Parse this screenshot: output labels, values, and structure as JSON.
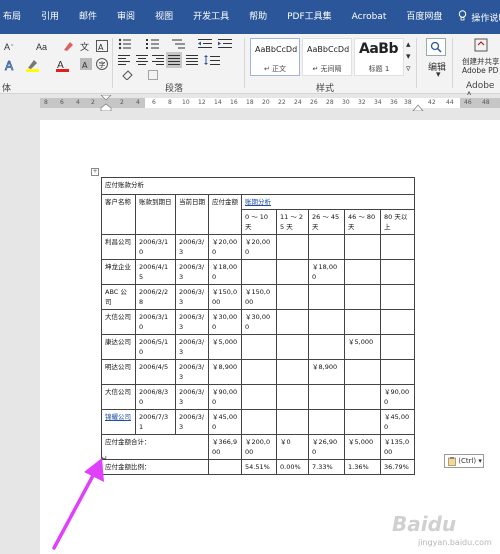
{
  "tabs": [
    "布局",
    "引用",
    "邮件",
    "审阅",
    "视图",
    "开发工具",
    "帮助",
    "PDF工具集",
    "Acrobat",
    "百度网盘"
  ],
  "search_label": "操作说明搜索",
  "ribbon": {
    "font_group_label": "体",
    "paragraph_group_label": "段落",
    "styles_group_label": "样式",
    "editing_label": "编辑",
    "create_label": "创建并共享",
    "adobe_pdf": "Adobe PD",
    "adobe_label": "Adobe A",
    "styles": [
      {
        "preview": "AaBbCcDd",
        "name": "↵ 正文"
      },
      {
        "preview": "AaBbCcDd",
        "name": "↵ 无间隔"
      },
      {
        "preview": "AaBb",
        "name": "标题 1"
      }
    ]
  },
  "ruler": {
    "left_ticks": [
      "8",
      "6",
      "4",
      "2"
    ],
    "ticks": [
      "2",
      "4",
      "6",
      "8",
      "10",
      "12",
      "14",
      "16",
      "18",
      "20",
      "22",
      "24",
      "26",
      "28",
      "30",
      "32",
      "34",
      "36",
      "38"
    ],
    "right_ticks": [
      "42",
      "44",
      "46",
      "48"
    ]
  },
  "table": {
    "title": "应付账款分析",
    "headers": {
      "customer": "客户名称",
      "account_date": "账款到期日",
      "current_date": "当前日期",
      "amount": "应付金额",
      "analysis": "账期分析",
      "buckets": [
        "0 ～ 10 天",
        "11 ～ 25 天",
        "26 ～ 45 天",
        "46 ～ 80 天",
        "80 天以上"
      ]
    },
    "rows": [
      {
        "name": "利昌公司",
        "due": "2006/3/10",
        "now": "2006/3/3",
        "amount": "￥20,000",
        "b": [
          "￥20,000",
          "",
          "",
          "",
          ""
        ]
      },
      {
        "name": "坤龙企业",
        "due": "2006/4/15",
        "now": "2006/3/3",
        "amount": "￥18,000",
        "b": [
          "",
          "",
          "￥18,000",
          "",
          ""
        ]
      },
      {
        "name": "ABC 公司",
        "due": "2006/2/28",
        "now": "2006/3/3",
        "amount": "￥150,000",
        "b": [
          "￥150,000",
          "",
          "",
          "",
          ""
        ]
      },
      {
        "name": "大信公司",
        "due": "2006/3/10",
        "now": "2006/3/3",
        "amount": "￥30,000",
        "b": [
          "￥30,000",
          "",
          "",
          "",
          ""
        ]
      },
      {
        "name": "康达公司",
        "due": "2006/5/10",
        "now": "2006/3/3",
        "amount": "￥5,000",
        "b": [
          "",
          "",
          "",
          "￥5,000",
          ""
        ]
      },
      {
        "name": "明达公司",
        "due": "2006/4/5",
        "now": "2006/3/3",
        "amount": "￥8,900",
        "b": [
          "",
          "",
          "￥8,900",
          "",
          ""
        ]
      },
      {
        "name": "大信公司",
        "due": "2006/8/30",
        "now": "2006/3/3",
        "amount": "￥90,000",
        "b": [
          "",
          "",
          "",
          "",
          "￥90,000"
        ]
      },
      {
        "name": "锦耀公司",
        "due": "2006/7/31",
        "now": "2006/3/3",
        "amount": "￥45,000",
        "b": [
          "",
          "",
          "",
          "",
          "￥45,000"
        ]
      }
    ],
    "total_label": "应付金额合计：",
    "total_amount": "￥366,900",
    "totals": [
      "￥200,000",
      "￥0",
      "￥26,900",
      "￥5,000",
      "￥135,000"
    ],
    "ratio_label": "应付金额比例：",
    "ratios": [
      "54.51%",
      "0.00%",
      "7.33%",
      "1.36%",
      "36.79%"
    ]
  },
  "paste_options": "(Ctrl)",
  "watermark": "Baidu",
  "watermark_sub": "jingyan.baidu.com",
  "colors": {
    "ribbon_tab": "#2b579a",
    "arrow": "#e040fb"
  }
}
